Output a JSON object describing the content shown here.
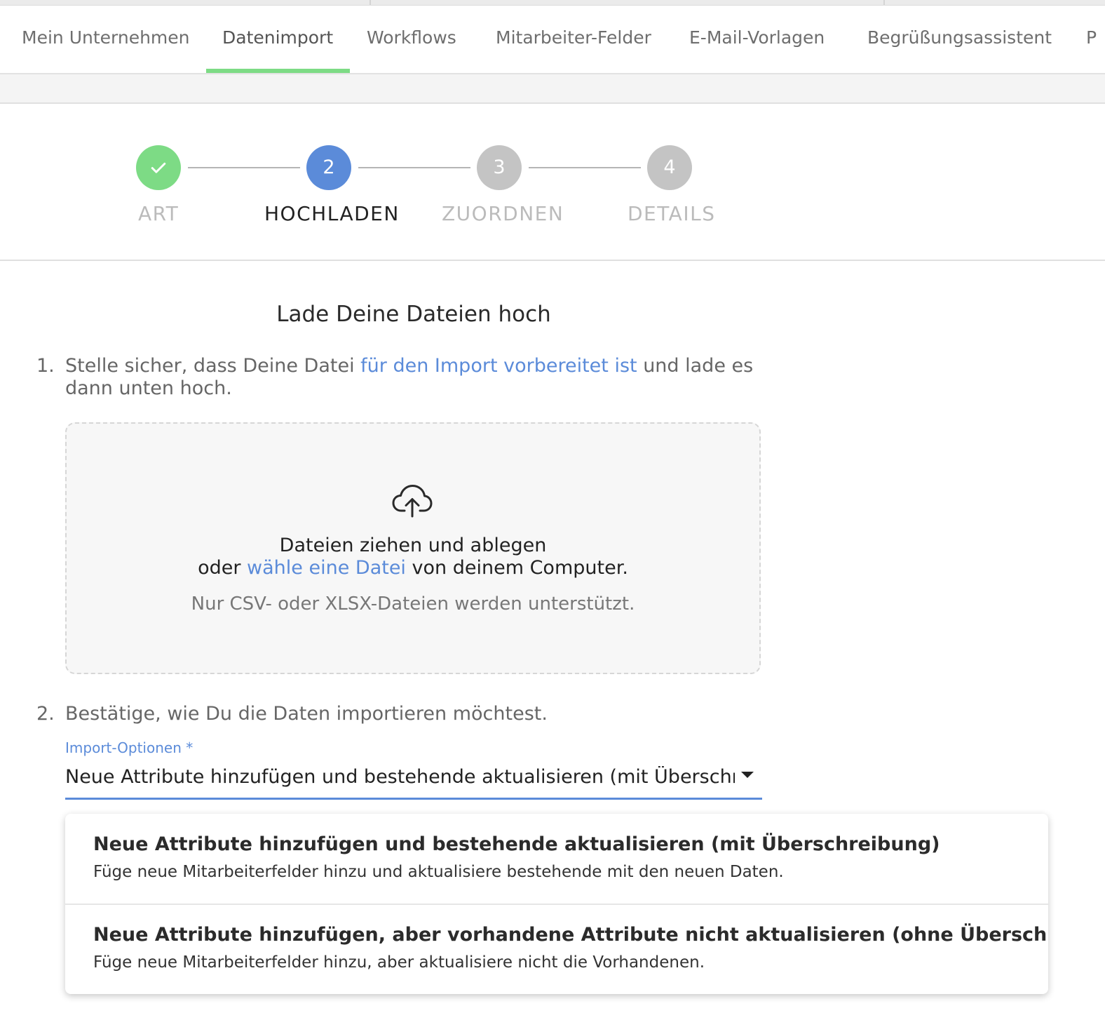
{
  "nav_tabs": [
    "Mein Unternehmen",
    "Datenimport",
    "Workflows",
    "Mitarbeiter-Felder",
    "E-Mail-Vorlagen",
    "Begrüßungsassistent",
    "P"
  ],
  "active_tab": "Datenimport",
  "stepper": {
    "steps": [
      {
        "number": "",
        "label": "ART",
        "state": "done"
      },
      {
        "number": "2",
        "label": "HOCHLADEN",
        "state": "current"
      },
      {
        "number": "3",
        "label": "ZUORDNEN",
        "state": "pending"
      },
      {
        "number": "4",
        "label": "DETAILS",
        "state": "pending"
      }
    ],
    "colors": {
      "done": "#7ddb85",
      "current": "#5b8bd9",
      "pending": "#c4c4c4"
    }
  },
  "upload": {
    "heading": "Lade Deine Dateien hoch",
    "step1": {
      "num": "1.",
      "before": "Stelle sicher, dass Deine Datei ",
      "link": "für den Import vorbereitet ist",
      "after": " und lade es dann unten hoch."
    },
    "dropzone": {
      "icon": "cloud-upload-icon",
      "line1": "Dateien ziehen und ablegen",
      "line2_before": "oder ",
      "line2_link": "wähle eine Datei",
      "line2_after": " von deinem Computer.",
      "hint": "Nur CSV- oder XLSX-Dateien werden unterstützt."
    },
    "step2": {
      "num": "2.",
      "text": "Bestätige, wie Du die Daten importieren möchtest."
    },
    "import_options": {
      "label": "Import-Optionen *",
      "value": "Neue Attribute hinzufügen und bestehende aktualisieren (mit Überschreibung)",
      "options": [
        {
          "title": "Neue Attribute hinzufügen und bestehende aktualisieren (mit Überschreibung)",
          "description": "Füge neue Mitarbeiterfelder hinzu und aktualisiere bestehende mit den neuen Daten."
        },
        {
          "title": "Neue Attribute hinzufügen, aber vorhandene Attribute nicht aktualisieren (ohne Überschreiben)",
          "description": "Füge neue Mitarbeiterfelder hinzu, aber aktualisiere nicht die Vorhandenen."
        }
      ]
    }
  },
  "theme": {
    "accent": "#5b8bd9",
    "success": "#7ddb85"
  }
}
